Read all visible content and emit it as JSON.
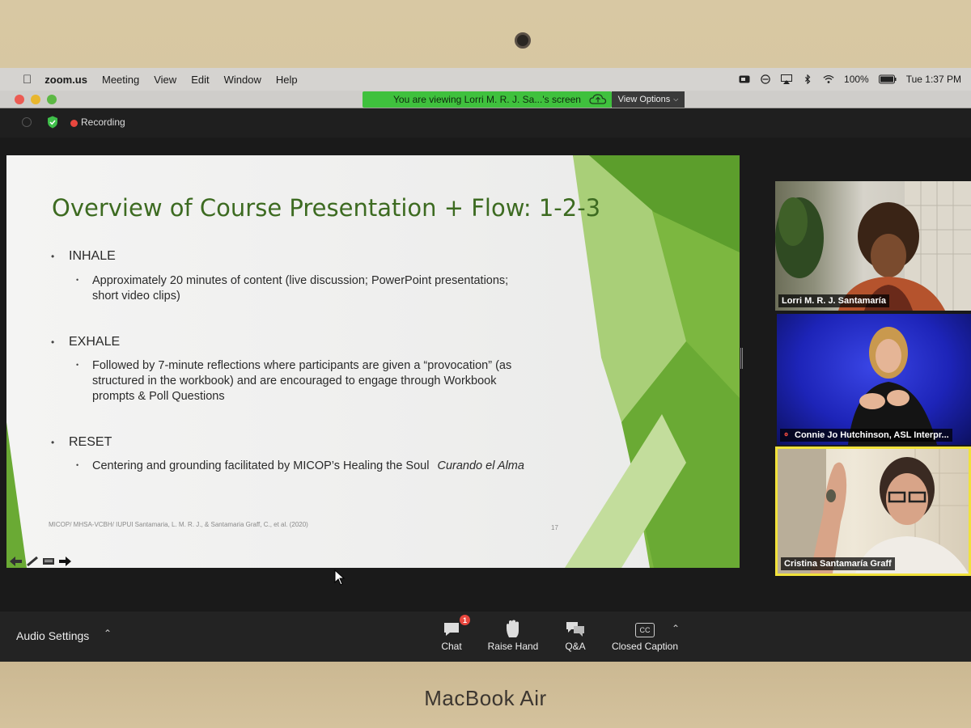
{
  "device": {
    "brand": "MacBook Air"
  },
  "menubar": {
    "app_name": "zoom.us",
    "items": [
      "Meeting",
      "View",
      "Edit",
      "Window",
      "Help"
    ],
    "battery": "100%",
    "clock": "Tue 1:37 PM"
  },
  "titlebar": {
    "share_banner": "You are viewing Lorri M. R. J. Sa...'s screen",
    "view_options": "View Options"
  },
  "meeting": {
    "recording_label": "Recording"
  },
  "slide": {
    "title": "Overview of Course Presentation + Flow: 1-2-3",
    "sections": [
      {
        "heading": "INHALE",
        "lines": [
          "Approximately 20 minutes of content (live discussion; PowerPoint presentations;",
          "short video clips)"
        ]
      },
      {
        "heading": "EXHALE",
        "lines": [
          "Followed by 7-minute reflections where participants are given a “provocation” (as",
          "structured in the workbook) and are encouraged to engage through Workbook",
          "prompts & Poll Questions"
        ]
      },
      {
        "heading": "RESET",
        "lines": [
          "Centering and grounding facilitated by MICOP’s Healing the Soul"
        ],
        "italic": "Curando el Alma"
      }
    ],
    "footer": "MICOP/ MHSA-VCBH/ IUPUI Santamaria, L. M. R. J., & Santamaria Graff, C., et al. (2020)",
    "page_number": "17"
  },
  "participants": [
    {
      "name": "Lorri M. R. J. Santamaría"
    },
    {
      "name": "Connie Jo Hutchinson, ASL Interpr..."
    },
    {
      "name": "Cristina Santamaría Graff"
    }
  ],
  "controls": {
    "audio_settings": "Audio Settings",
    "chat": "Chat",
    "chat_badge": "1",
    "raise_hand": "Raise Hand",
    "qa": "Q&A",
    "closed_caption": "Closed Caption",
    "cc_icon_text": "CC"
  },
  "colors": {
    "share_banner": "#3fc13d",
    "slide_title": "#3d6b21",
    "recording_dot": "#e8473e",
    "active_speaker_border": "#f1e23a"
  }
}
